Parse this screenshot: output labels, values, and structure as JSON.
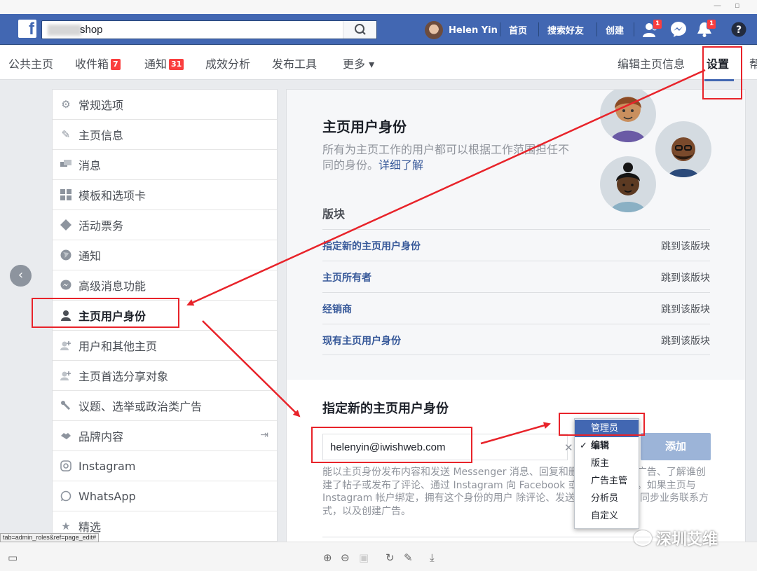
{
  "header": {
    "search_value": "shop",
    "user_name": "Helen Yin",
    "nav": [
      "首页",
      "搜索好友",
      "创建"
    ],
    "friend_badge": "1",
    "notif_badge": "1"
  },
  "page_tabs": {
    "items": [
      {
        "label": "公共主页",
        "count": ""
      },
      {
        "label": "收件箱",
        "count": "7"
      },
      {
        "label": "通知",
        "count": "31"
      },
      {
        "label": "成效分析",
        "count": ""
      },
      {
        "label": "发布工具",
        "count": ""
      },
      {
        "label": "更多 ▾",
        "count": ""
      }
    ],
    "right": [
      "编辑主页信息",
      "设置",
      "帮"
    ]
  },
  "sidebar": {
    "items": [
      {
        "label": "常规选项",
        "icon": "gear-icon"
      },
      {
        "label": "主页信息",
        "icon": "pencil-icon"
      },
      {
        "label": "消息",
        "icon": "chat-icon"
      },
      {
        "label": "模板和选项卡",
        "icon": "grid-icon"
      },
      {
        "label": "活动票务",
        "icon": "ticket-icon"
      },
      {
        "label": "通知",
        "icon": "globe-icon"
      },
      {
        "label": "高级消息功能",
        "icon": "messenger-icon"
      },
      {
        "label": "主页用户身份",
        "icon": "person-icon"
      },
      {
        "label": "用户和其他主页",
        "icon": "person-add-icon"
      },
      {
        "label": "主页首选分享对象",
        "icon": "person-add-icon"
      },
      {
        "label": "议题、选举或政治类广告",
        "icon": "wrench-icon"
      },
      {
        "label": "品牌内容",
        "icon": "handshake-icon"
      },
      {
        "label": "Instagram",
        "icon": "instagram-icon"
      },
      {
        "label": "WhatsApp",
        "icon": "whatsapp-icon"
      },
      {
        "label": "精选",
        "icon": "star-icon"
      }
    ],
    "active_index": 7
  },
  "main": {
    "title": "主页用户身份",
    "desc": "所有为主页工作的用户都可以根据工作范围担任不同的身份。",
    "learn_more": "详细了解",
    "section_title": "版块",
    "rows": [
      {
        "label": "指定新的主页用户身份",
        "link": "跳到该版块"
      },
      {
        "label": "主页所有者",
        "link": "跳到该版块"
      },
      {
        "label": "经销商",
        "link": "跳到该版块"
      },
      {
        "label": "现有主页用户身份",
        "link": "跳到该版块"
      }
    ],
    "assign_title": "指定新的主页用户身份",
    "email_value": "helenyin@iwishweb.com",
    "add_label": "添加",
    "help_text": "能以主页身份发布内容和发送 Messenger 消息、回复和删除评论、创建广告、了解谁创建了帖子或发布了评论、通过 Instagram 向 Facebook 或查看成效分析。如果主页与 Instagram 帐户绑定，拥有这个身份的用户 除评论、发送 Direct 消息、同步业务联系方式，以及创建广告。"
  },
  "dropdown": {
    "items": [
      "管理员",
      "编辑",
      "版主",
      "广告主管",
      "分析员",
      "自定义"
    ],
    "highlighted_index": 0,
    "selected_index": 1
  },
  "status_url": "tab=admin_roles&ref=page_edit#",
  "watermark": "深圳艾维",
  "colors": {
    "fb_blue": "#4267b2",
    "link": "#365899",
    "annotation_red": "#e8232a",
    "badge_red": "#fa3e3e"
  }
}
